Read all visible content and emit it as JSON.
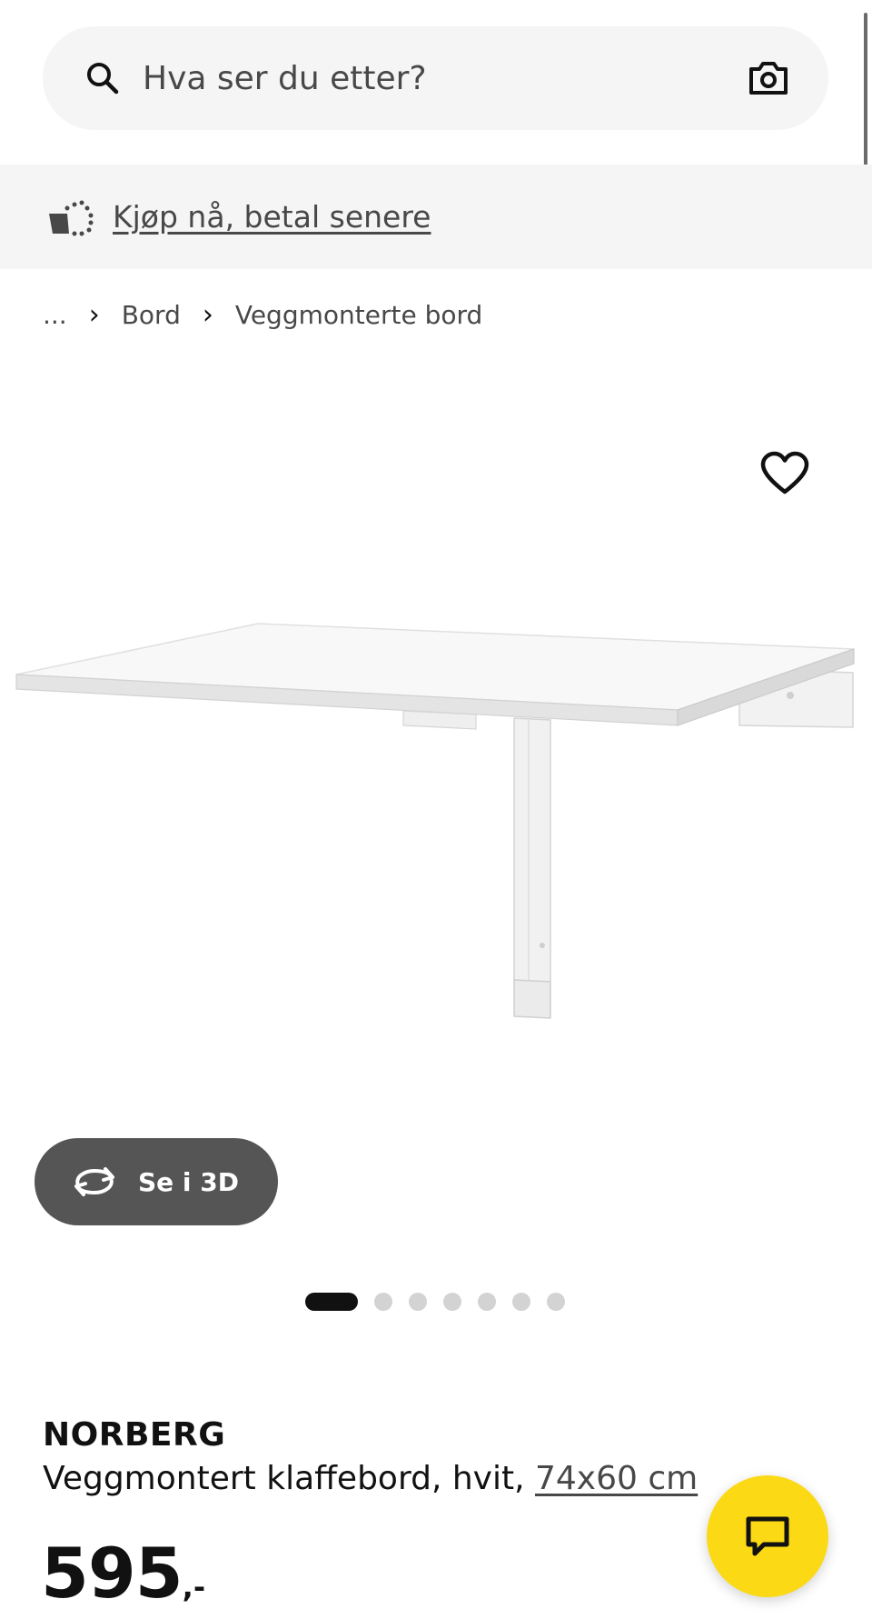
{
  "search": {
    "placeholder": "Hva ser du etter?",
    "icon": "search-icon",
    "camera_icon": "camera-icon"
  },
  "promo": {
    "icon": "payment-icon",
    "link_label": "Kjøp nå, betal senere"
  },
  "breadcrumb": {
    "items": [
      "...",
      "Bord",
      "Veggmonterte bord"
    ],
    "separator": "›"
  },
  "wishlist": {
    "icon": "heart-icon"
  },
  "product_image": {
    "description_icon": "wall-mounted-drop-leaf-table-image"
  },
  "viewer_3d": {
    "label": "Se i 3D",
    "icon": "rotate-icon"
  },
  "carousel": {
    "total": 7,
    "active_index": 0
  },
  "product": {
    "name": "NORBERG",
    "description": "Veggmontert klaffebord, hvit, ",
    "size": "74x60 cm",
    "price": "595",
    "price_suffix": ",-"
  },
  "chat": {
    "icon": "chat-bubble-icon"
  },
  "colors": {
    "accent_yellow": "#fbd914",
    "surface_gray": "#f5f5f5",
    "button_dark": "#555555",
    "text_primary": "#111111",
    "text_secondary": "#484848"
  }
}
